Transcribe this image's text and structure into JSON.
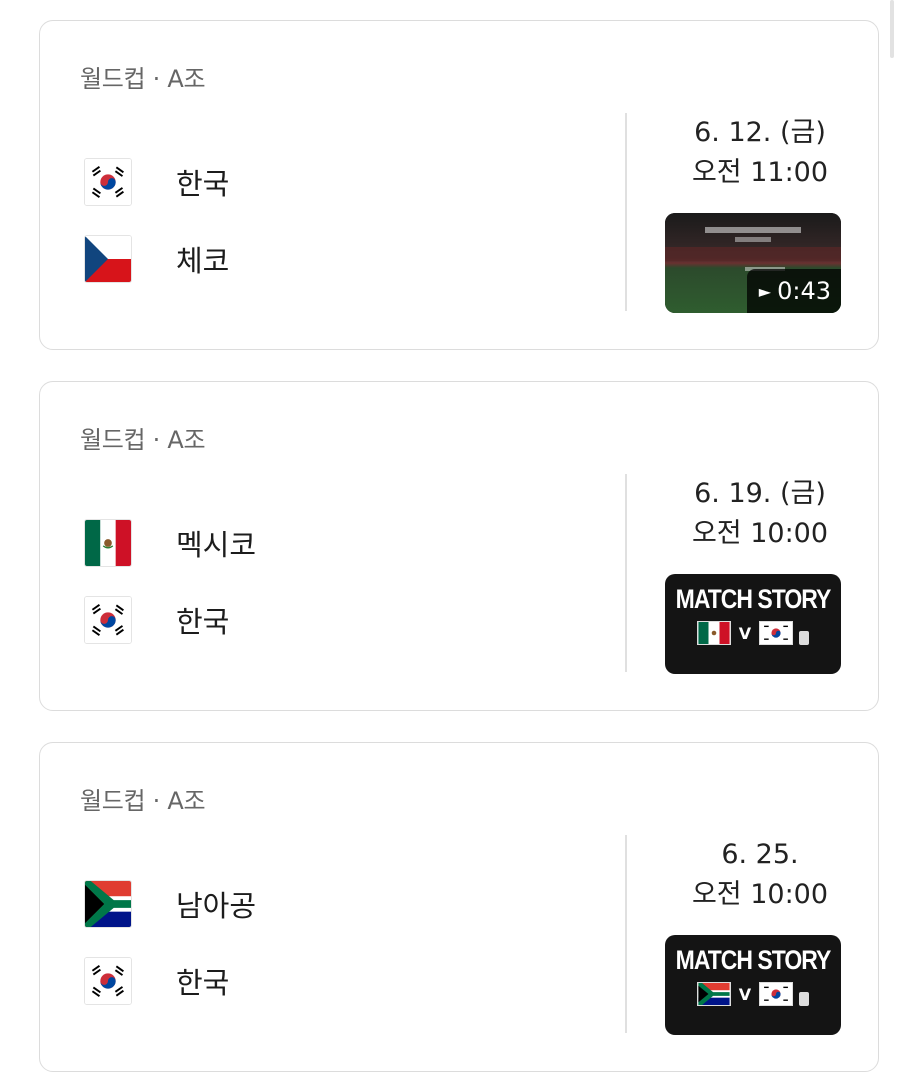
{
  "matches": [
    {
      "label": "월드컵 · A조",
      "teams": [
        {
          "name": "한국",
          "flag": "korea-flag"
        },
        {
          "name": "체코",
          "flag": "czech-flag"
        }
      ],
      "date": "6. 12. (금)",
      "time": "오전 11:00",
      "media": {
        "type": "video",
        "duration": "0:43"
      }
    },
    {
      "label": "월드컵 · A조",
      "teams": [
        {
          "name": "멕시코",
          "flag": "mexico-flag"
        },
        {
          "name": "한국",
          "flag": "korea-flag"
        }
      ],
      "date": "6. 19. (금)",
      "time": "오전 10:00",
      "media": {
        "type": "match-story",
        "title": "MATCH STORY",
        "vs": "V"
      }
    },
    {
      "label": "월드컵 · A조",
      "teams": [
        {
          "name": "남아공",
          "flag": "south-africa-flag"
        },
        {
          "name": "한국",
          "flag": "korea-flag"
        }
      ],
      "date": "6. 25.",
      "time": "오전 10:00",
      "media": {
        "type": "match-story",
        "title": "MATCH STORY",
        "vs": "V"
      }
    }
  ]
}
